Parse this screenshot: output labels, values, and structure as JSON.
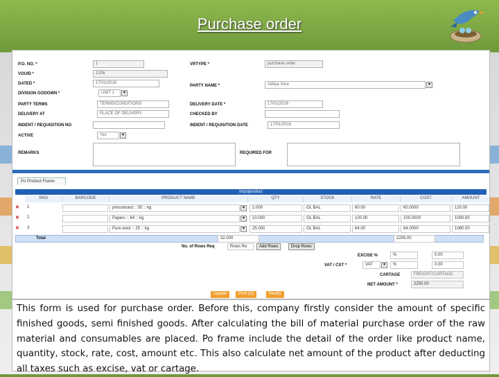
{
  "slide": {
    "title": "Purchase order"
  },
  "form": {
    "po_no": {
      "label": "P.O. NO. *",
      "value": "1"
    },
    "vrtype": {
      "label": "VRTYPE *",
      "value": "purchase order"
    },
    "vouid": {
      "label": "VOUID *",
      "value": "1206"
    },
    "dated": {
      "label": "DATED *",
      "value": "17/01/2016"
    },
    "party_name": {
      "label": "PARTY NAME *",
      "value": "Aditya Vora"
    },
    "division_godown": {
      "label": "DIVISION GODOWN *",
      "value": "UNIT 1"
    },
    "party_terms": {
      "label": "PARTY TERMS",
      "value": "TERMS/CONDITIONS"
    },
    "delivery_date": {
      "label": "DELIVERY DATE *",
      "value": "17/01/2016"
    },
    "delivery_at": {
      "label": "DELIVERY AT",
      "value": "PLACE OF DELIVERY"
    },
    "checked_by": {
      "label": "CHECKED BY",
      "value": ""
    },
    "indent_no": {
      "label": "INDENT / REQUISITION NO",
      "value": ""
    },
    "indent_date": {
      "label": "INDENT / REQUISITION DATE",
      "value": "17/01/2016"
    },
    "active": {
      "label": "ACTIVE",
      "value": "Yes"
    },
    "remarks": {
      "label": "REMARKS",
      "value": ""
    },
    "required_for": {
      "label": "REQUIRED FOR",
      "value": ""
    }
  },
  "grid": {
    "tab": "Po Product Frame",
    "title": "trnpoproduct",
    "columns": [
      "SNO",
      "BARCODE",
      "PRODUCT NAME",
      "QTY",
      "STOCK",
      "RATE",
      "COST",
      "AMOUNT"
    ],
    "rows": [
      {
        "sno": "1",
        "barcode": "",
        "product": "pressboard :: 30 :: kg",
        "qty": "2.000",
        "stock": "OL BAL",
        "rate": "60.00",
        "cost": "60.0000",
        "amount": "120.00"
      },
      {
        "sno": "2",
        "barcode": "",
        "product": "Papers :: 64 :: kg",
        "qty": "10.000",
        "stock": "OL BAL",
        "rate": "100.00",
        "cost": "100.0000",
        "amount": "1000.00"
      },
      {
        "sno": "3",
        "barcode": "",
        "product": "Pure wool :: 25 :: kg",
        "qty": "25.000",
        "stock": "OL BAL",
        "rate": "64.00",
        "cost": "64.0000",
        "amount": "1080.00"
      }
    ],
    "total_label": "Total",
    "total_qty": "32.000",
    "total_amount": "2205.00",
    "rows_req_label": "No. of Rows Req",
    "rows_req_placeholder": "Rows Re",
    "add_rows": "Add Rows",
    "drop_rows": "Drop Rows"
  },
  "charges": {
    "excise_label": "EXCISE %",
    "excise_pct": "%",
    "excise_amt": "0.00",
    "vat_label": "VAT / CST *",
    "vat_select": "VAT",
    "vat_pct": "%",
    "vat_amt": "0.00",
    "cartage_label": "CARTAGE",
    "cartage_value": "FREIGHT/CARTAGE",
    "net_label": "NET AMOUNT *",
    "net_value": "2250.00"
  },
  "actions": {
    "update": "Update",
    "print": "Print (D)",
    "modify": "Modify"
  },
  "description": "This form is used for purchase order. Before this, company firstly consider the amount of specific finished goods, semi finished goods. After calculating the bill of material purchase order of the raw material and consumables are placed. Po frame include the detail of the order like product name, quantity, stock, rate, cost, amount etc. This also calculate net amount of the product after deducting all taxes such as excise, vat or cartage."
}
